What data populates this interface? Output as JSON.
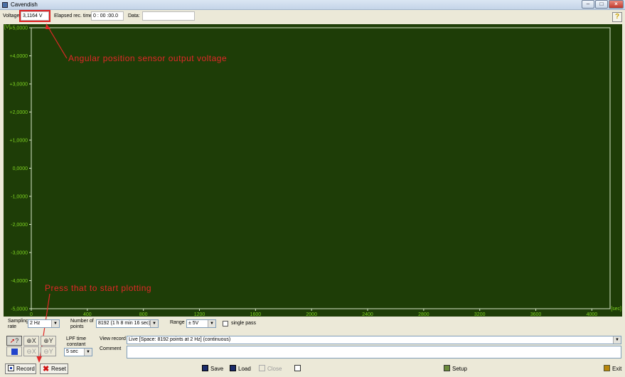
{
  "window": {
    "title": "Cavendish"
  },
  "topbar": {
    "voltage_label": "Voltage:",
    "voltage_value": "3,1164 V",
    "elapsed_label": "Elapsed rec. time:",
    "elapsed_value": "0 : 00 :00.0",
    "data_label": "Data:",
    "data_value": "",
    "help_label": "?"
  },
  "plot": {
    "y_unit": "[V]",
    "x_unit": "[sec]",
    "y_ticks": [
      "+5,0000",
      "+4,0000",
      "+3,0000",
      "+2,0000",
      "+1,0000",
      "0,0000",
      "-1,0000",
      "-2,0000",
      "-3,0000",
      "-4,0000",
      "-5,0000"
    ],
    "x_ticks": [
      "0",
      "400",
      "800",
      "1200",
      "1600",
      "2000",
      "2400",
      "2800",
      "3200",
      "3600",
      "4000"
    ],
    "colors": {
      "background": "#1e3d07",
      "axis": "#d8e8c8",
      "tick_label": "#7ed321"
    }
  },
  "annotations": {
    "voltage_note": "Angular position sensor output voltage",
    "record_note": "Press that to start plotting",
    "color": "#e22828"
  },
  "controls": {
    "sampling_rate_label": "Sampling rate",
    "sampling_rate_value": "2 Hz",
    "number_points_label": "Number of points",
    "number_points_value": "8192 (1 h 8 min 16 sec)",
    "range_label": "Range",
    "range_value": "± 5V",
    "single_pass_label": "single pass",
    "lpf_label": "LPF time constant",
    "lpf_value": "5 sec",
    "view_record_label": "View record",
    "view_record_value": "Live [Space: 8192 points at 2 Hz] (continuous)",
    "comment_label": "Comment",
    "comment_value": "",
    "zoom_tools": [
      "?",
      "X",
      "Y",
      "X",
      "Y"
    ]
  },
  "buttons": {
    "record": "Record",
    "reset": "Reset",
    "save": "Save",
    "load": "Load",
    "close": "Close",
    "setup": "Setup",
    "exit": "Exit"
  }
}
